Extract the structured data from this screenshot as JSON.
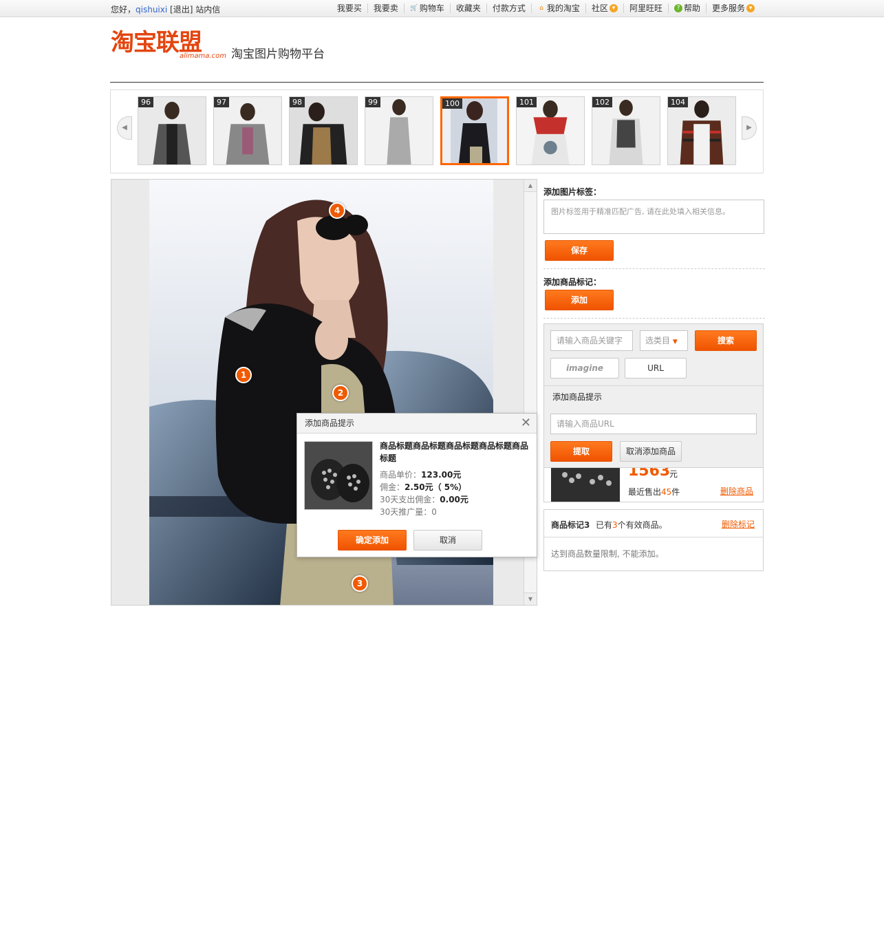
{
  "topbar": {
    "greeting": "您好，",
    "username": "qishuixi",
    "logout": "[退出]",
    "messages": "站内信",
    "nav": [
      "我要买",
      "我要卖",
      "购物车",
      "收藏夹",
      "付款方式",
      "我的淘宝",
      "社区",
      "阿里旺旺",
      "帮助",
      "更多服务"
    ]
  },
  "header": {
    "logo_cn": "淘宝联盟",
    "logo_en": "alimama.com",
    "site_title": "淘宝图片购物平台"
  },
  "carousel": {
    "thumbs": [
      {
        "num": "96",
        "color": "#5a5a5a"
      },
      {
        "num": "97",
        "color": "#777777"
      },
      {
        "num": "98",
        "color": "#6b5a3f"
      },
      {
        "num": "99",
        "color": "#a9a9a9"
      },
      {
        "num": "100",
        "color": "#2d2d33"
      },
      {
        "num": "101",
        "color": "#c4302b"
      },
      {
        "num": "102",
        "color": "#444444"
      },
      {
        "num": "104",
        "color": "#5b2c1e"
      }
    ],
    "selected_num": "100"
  },
  "image_panel": {
    "markers": [
      "1",
      "2",
      "3",
      "4"
    ]
  },
  "popup": {
    "title": "添加商品提示",
    "product_title": "商品标题商品标题商品标题商品标题商品标题",
    "price_label": "商品单价：",
    "price_value": "123.00元",
    "commission_label": "佣金：",
    "commission_value": "2.50元（ 5%）",
    "expense_label": "30天支出佣金：",
    "expense_value": "0.00元",
    "promo_label": "30天推广量：",
    "promo_value": "0",
    "confirm": "确定添加",
    "cancel": "取消"
  },
  "right": {
    "tag_label": "添加图片标签：",
    "tag_placeholder": "图片标签用于精准匹配广告, 请在此处填入相关信息。",
    "save": "保存",
    "mark_label": "添加商品标记：",
    "add": "添加",
    "keyword_placeholder": "请输入商品关键字",
    "category_select": "选类目",
    "search": "搜索",
    "imagine": "imagine",
    "url_tab": "URL",
    "hint_title": "添加商品提示",
    "url_placeholder": "请输入商品URL",
    "fetch": "提取",
    "cancel_add": "取消添加商品",
    "product_price": "1563",
    "product_unit": "元",
    "sold_prefix": "最近售出",
    "sold_count": "45",
    "sold_suffix": "件",
    "delete_product": "删除商品",
    "marker3_title": "商品标记3",
    "marker3_info_prefix": "已有",
    "marker3_count": "3",
    "marker3_info_suffix": "个有效商品。",
    "delete_marker": "删除标记",
    "limit_note": "达到商品数量限制, 不能添加。"
  },
  "colors": {
    "accent": "#f05a00",
    "link": "#3366cc"
  }
}
